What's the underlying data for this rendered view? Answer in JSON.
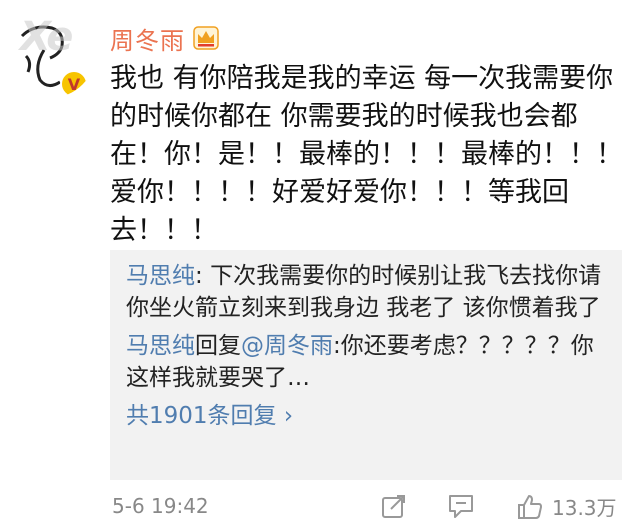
{
  "post": {
    "username": "周冬雨",
    "text": "我也  有你陪我是我的幸运  每一次我需要你的时候你都在   你需要我的时候我也会都在！你！是！！最棒的！！！最棒的！！！爱你！！！！好爱好爱你！！！等我回去！！！"
  },
  "replies": [
    {
      "author": "马思纯",
      "separator": ": ",
      "text": "下次我需要你的时候别让我飞去找你请你坐火箭立刻来到我身边 我老了 该你惯着我了"
    },
    {
      "author": "马思纯",
      "action": "回复",
      "mention": "@周冬雨",
      "text": ":你还要考虑？？？？？你这样我就要哭了…"
    }
  ],
  "more_replies": "共1901条回复 ›",
  "footer": {
    "timestamp": "5-6 19:42",
    "likes": "13.3万"
  },
  "colors": {
    "username": "#eb7350",
    "link": "#507daf",
    "reply_bg": "#f2f2f2",
    "muted": "#888888"
  },
  "icons": [
    "avatar",
    "verified-badge-icon",
    "crown-icon",
    "share-icon",
    "comment-icon",
    "like-icon"
  ]
}
